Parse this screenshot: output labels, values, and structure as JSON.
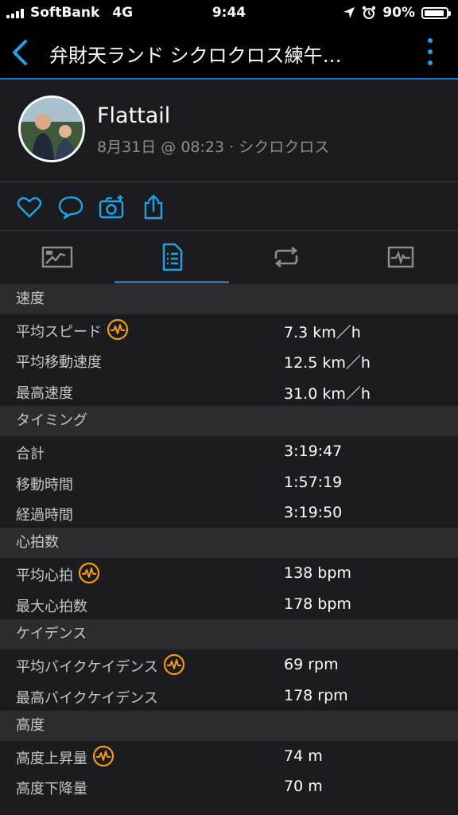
{
  "status_bar": {
    "carrier": "SoftBank",
    "network": "4G",
    "time": "9:44",
    "battery": "90%"
  },
  "nav": {
    "title": "弁財天ランド シクロクロス練午…"
  },
  "profile": {
    "name": "Flattail",
    "subtitle": "8月31日 @ 08:23 · シクロクロス"
  },
  "icons": {
    "accent_blue": "#1fa3e8",
    "badge_orange": "#f39c12"
  },
  "sections": [
    {
      "title": "速度",
      "rows": [
        {
          "label": "平均スピード",
          "value": "7.3 km／h",
          "badge": true
        },
        {
          "label": "平均移動速度",
          "value": "12.5 km／h",
          "badge": false
        },
        {
          "label": "最高速度",
          "value": "31.0 km／h",
          "badge": false
        }
      ]
    },
    {
      "title": "タイミング",
      "rows": [
        {
          "label": "合計",
          "value": "3:19:47",
          "badge": false
        },
        {
          "label": "移動時間",
          "value": "1:57:19",
          "badge": false
        },
        {
          "label": "経過時間",
          "value": "3:19:50",
          "badge": false
        }
      ]
    },
    {
      "title": "心拍数",
      "rows": [
        {
          "label": "平均心拍",
          "value": "138 bpm",
          "badge": true
        },
        {
          "label": "最大心拍数",
          "value": "178 bpm",
          "badge": false
        }
      ]
    },
    {
      "title": "ケイデンス",
      "rows": [
        {
          "label": "平均バイクケイデンス",
          "value": "69 rpm",
          "badge": true
        },
        {
          "label": "最高バイクケイデンス",
          "value": "178 rpm",
          "badge": false
        }
      ]
    },
    {
      "title": "高度",
      "rows": [
        {
          "label": "高度上昇量",
          "value": "74 m",
          "badge": true
        },
        {
          "label": "高度下降量",
          "value": "70 m",
          "badge": false
        }
      ]
    }
  ]
}
